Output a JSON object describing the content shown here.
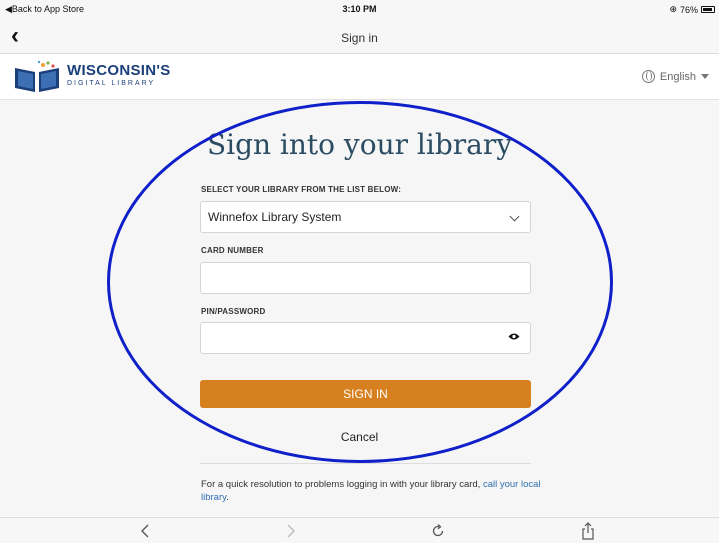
{
  "status_bar": {
    "back_to_app": "Back to App Store",
    "time": "3:10 PM",
    "battery": "76%"
  },
  "nav": {
    "title": "Sign in"
  },
  "header": {
    "logo_main": "WISCONSIN'S",
    "logo_sub": "DIGITAL LIBRARY",
    "language": "English"
  },
  "form": {
    "title": "Sign into your library",
    "library_label": "SELECT YOUR LIBRARY FROM THE LIST BELOW:",
    "library_selected": "Winnefox Library System",
    "card_label": "CARD NUMBER",
    "card_value": "",
    "pin_label": "PIN/PASSWORD",
    "pin_value": "",
    "sign_in_label": "SIGN IN",
    "cancel_label": "Cancel",
    "help_prefix": "For a quick resolution to problems logging in with your library card, ",
    "help_link": "call your local library",
    "help_suffix": "."
  },
  "colors": {
    "accent": "#d6801f",
    "title": "#2b4c63",
    "link": "#2f6fb0",
    "annotation": "#0f1fc9"
  }
}
